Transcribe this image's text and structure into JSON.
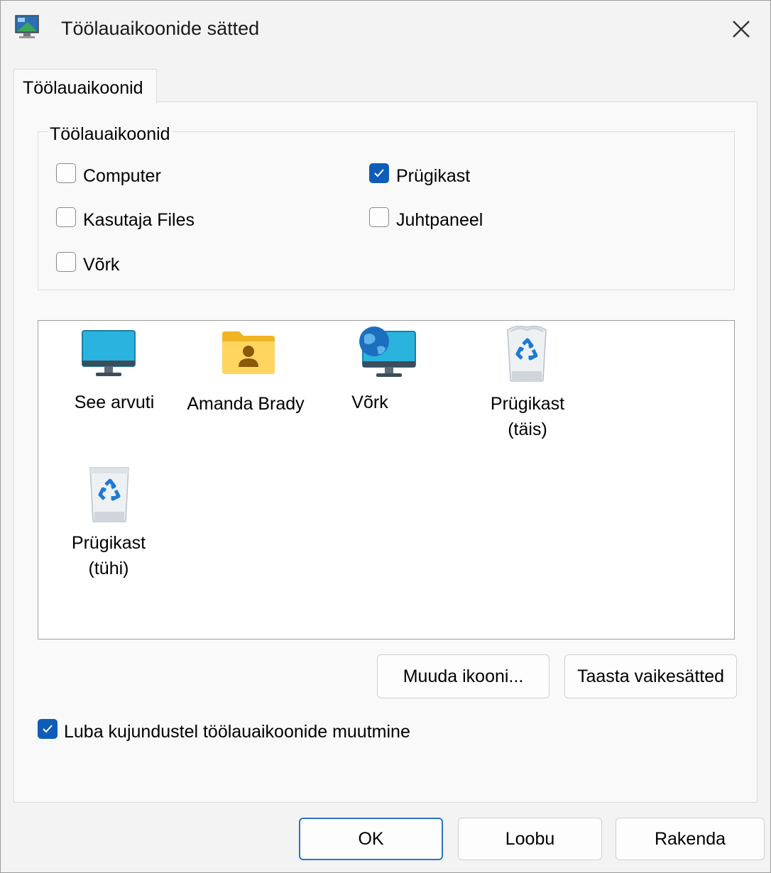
{
  "window": {
    "title": "Töölauaikoonide sätted"
  },
  "tab": {
    "label": "Töölauaikoonid"
  },
  "group": {
    "legend": "Töölauaikoonid",
    "checkboxes": [
      {
        "label": "Computer",
        "checked": false
      },
      {
        "label": "Prügikast",
        "checked": true
      },
      {
        "label": "Kasutaja Files",
        "checked": false
      },
      {
        "label": "Juhtpaneel",
        "checked": false
      },
      {
        "label": "Võrk",
        "checked": false
      }
    ]
  },
  "icons": [
    {
      "icon": "monitor-icon",
      "label": "See arvuti"
    },
    {
      "icon": "user-folder-icon",
      "label": "Amanda Brady"
    },
    {
      "icon": "network-globe-icon",
      "label": "Võrk"
    },
    {
      "icon": "recycle-bin-full-icon",
      "label_line1": "Prügikast",
      "label_line2": "(täis)"
    },
    {
      "icon": "recycle-bin-empty-icon",
      "label_line1": "Prügikast",
      "label_line2": "(tühi)"
    }
  ],
  "buttons": {
    "change_icon": "Muuda ikooni...",
    "restore_default": "Taasta vaikesätted",
    "ok": "OK",
    "cancel": "Loobu",
    "apply": "Rakenda"
  },
  "allow_themes": {
    "label": "Luba kujundustel töölauaikoonide muutmine",
    "checked": true
  },
  "colors": {
    "accent": "#0f5cb8",
    "monitor": "#29b6e0",
    "folder": "#f5c842"
  }
}
